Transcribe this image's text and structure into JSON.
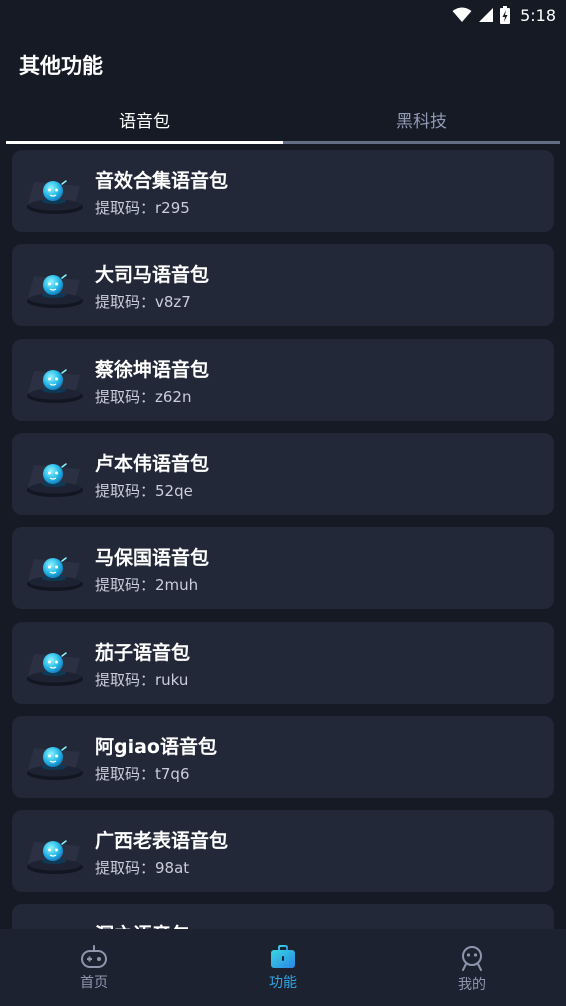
{
  "status_bar": {
    "time": "5:18"
  },
  "header": {
    "title": "其他功能"
  },
  "tabs": [
    {
      "label": "语音包",
      "active": true
    },
    {
      "label": "黑科技",
      "active": false
    }
  ],
  "items": [
    {
      "title": "音效合集语音包",
      "code": "提取码：r295"
    },
    {
      "title": "大司马语音包",
      "code": "提取码：v8z7"
    },
    {
      "title": "蔡徐坤语音包",
      "code": "提取码：z62n"
    },
    {
      "title": "卢本伟语音包",
      "code": "提取码：52qe"
    },
    {
      "title": "马保国语音包",
      "code": "提取码：2muh"
    },
    {
      "title": "茄子语音包",
      "code": "提取码：ruku"
    },
    {
      "title": "阿giao语音包",
      "code": "提取码：t7q6"
    },
    {
      "title": "广西老表语音包",
      "code": "提取码：98at"
    },
    {
      "title": "洞之语音包",
      "code": ""
    }
  ],
  "bottom_nav": [
    {
      "label": "首页",
      "icon": "gamepad-icon",
      "active": false
    },
    {
      "label": "功能",
      "icon": "toolbox-icon",
      "active": true
    },
    {
      "label": "我的",
      "icon": "robot-face-icon",
      "active": false
    }
  ],
  "colors": {
    "background": "#161a25",
    "card": "#232838",
    "accent": "#2fa6e6",
    "inactive": "#8d96ab"
  }
}
